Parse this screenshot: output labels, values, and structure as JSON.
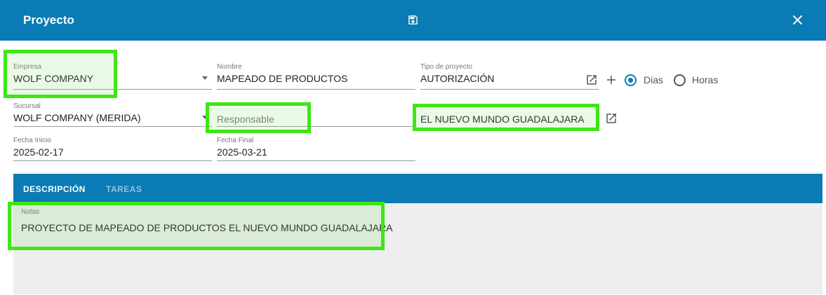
{
  "header": {
    "title": "Proyecto",
    "save_icon": "save-icon",
    "close_icon": "close-icon"
  },
  "form": {
    "empresa": {
      "label": "Empresa",
      "value": "WOLF COMPANY"
    },
    "nombre": {
      "label": "Nombre",
      "value": "MAPEADO DE PRODUCTOS"
    },
    "tipo": {
      "label": "Tipo de proyecto",
      "value": "AUTORIZACIÓN"
    },
    "sucursal": {
      "label": "Sucursal",
      "value": "WOLF COMPANY (MERIDA)"
    },
    "responsable": {
      "placeholder": "Responsable"
    },
    "cliente": {
      "value": "EL NUEVO MUNDO GUADALAJARA"
    },
    "fecha_inicio": {
      "label": "Fecha Inicio",
      "value": "2025-02-17"
    },
    "fecha_final": {
      "label": "Fecha Final",
      "value": "2025-03-21"
    },
    "unidad": {
      "selected": "Dias",
      "options": [
        "Dias",
        "Horas"
      ]
    }
  },
  "tabs": [
    {
      "label": "DESCRIPCIÓN",
      "active": true
    },
    {
      "label": "TAREAS",
      "active": false
    }
  ],
  "notes": {
    "label": "Notas",
    "value": "PROYECTO DE MAPEADO DE PRODUCTOS EL NUEVO MUNDO GUADALAJARA"
  },
  "colors": {
    "header": "#0a7bb5",
    "highlight": "#3ee615"
  }
}
